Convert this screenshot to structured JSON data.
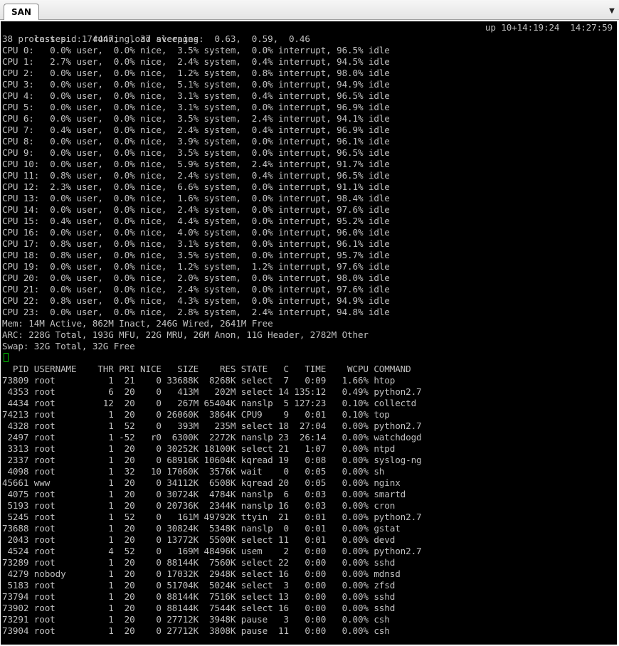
{
  "tab": {
    "label": "SAN"
  },
  "summary": {
    "left": "last pid: 74447;  load averages:  0.63,  0.59,  0.46",
    "uptime": "up 10+14:19:24  14:27:59",
    "processes": "38 processes:  1 running, 37 sleeping"
  },
  "cpus": [
    "CPU 0:   0.0% user,  0.0% nice,  3.5% system,  0.0% interrupt, 96.5% idle",
    "CPU 1:   2.7% user,  0.0% nice,  2.4% system,  0.4% interrupt, 94.5% idle",
    "CPU 2:   0.0% user,  0.0% nice,  1.2% system,  0.8% interrupt, 98.0% idle",
    "CPU 3:   0.0% user,  0.0% nice,  5.1% system,  0.0% interrupt, 94.9% idle",
    "CPU 4:   0.0% user,  0.0% nice,  3.1% system,  0.4% interrupt, 96.5% idle",
    "CPU 5:   0.0% user,  0.0% nice,  3.1% system,  0.0% interrupt, 96.9% idle",
    "CPU 6:   0.0% user,  0.0% nice,  3.5% system,  2.4% interrupt, 94.1% idle",
    "CPU 7:   0.4% user,  0.0% nice,  2.4% system,  0.4% interrupt, 96.9% idle",
    "CPU 8:   0.0% user,  0.0% nice,  3.9% system,  0.0% interrupt, 96.1% idle",
    "CPU 9:   0.0% user,  0.0% nice,  3.5% system,  0.0% interrupt, 96.5% idle",
    "CPU 10:  0.0% user,  0.0% nice,  5.9% system,  2.4% interrupt, 91.7% idle",
    "CPU 11:  0.8% user,  0.0% nice,  2.4% system,  0.4% interrupt, 96.5% idle",
    "CPU 12:  2.3% user,  0.0% nice,  6.6% system,  0.0% interrupt, 91.1% idle",
    "CPU 13:  0.0% user,  0.0% nice,  1.6% system,  0.0% interrupt, 98.4% idle",
    "CPU 14:  0.0% user,  0.0% nice,  2.4% system,  0.0% interrupt, 97.6% idle",
    "CPU 15:  0.4% user,  0.0% nice,  4.4% system,  0.0% interrupt, 95.2% idle",
    "CPU 16:  0.0% user,  0.0% nice,  4.0% system,  0.0% interrupt, 96.0% idle",
    "CPU 17:  0.8% user,  0.0% nice,  3.1% system,  0.0% interrupt, 96.1% idle",
    "CPU 18:  0.8% user,  0.0% nice,  3.5% system,  0.0% interrupt, 95.7% idle",
    "CPU 19:  0.0% user,  0.0% nice,  1.2% system,  1.2% interrupt, 97.6% idle",
    "CPU 20:  0.0% user,  0.0% nice,  2.0% system,  0.0% interrupt, 98.0% idle",
    "CPU 21:  0.0% user,  0.0% nice,  2.4% system,  0.0% interrupt, 97.6% idle",
    "CPU 22:  0.8% user,  0.0% nice,  4.3% system,  0.0% interrupt, 94.9% idle",
    "CPU 23:  0.0% user,  0.0% nice,  2.8% system,  2.4% interrupt, 94.8% idle"
  ],
  "mem": "Mem: 14M Active, 862M Inact, 246G Wired, 2641M Free",
  "arc": "ARC: 228G Total, 193G MFU, 22G MRU, 26M Anon, 11G Header, 2782M Other",
  "swap": "Swap: 32G Total, 32G Free",
  "table": {
    "header": "  PID USERNAME    THR PRI NICE   SIZE    RES STATE   C   TIME    WCPU COMMAND",
    "rows": [
      "73809 root          1  21    0 33688K  8268K select  7   0:09   1.66% htop",
      " 4353 root          6  20    0   413M   202M select 14 135:12   0.49% python2.7",
      " 4434 root         12  20    0   267M 65404K nanslp  5 127:23   0.10% collectd",
      "74213 root          1  20    0 26060K  3864K CPU9    9   0:01   0.10% top",
      " 4328 root          1  52    0   393M   235M select 18  27:04   0.00% python2.7",
      " 2497 root          1 -52   r0  6300K  2272K nanslp 23  26:14   0.00% watchdogd",
      " 3313 root          1  20    0 30252K 18100K select 21   1:07   0.00% ntpd",
      " 2337 root          1  20    0 68916K 10604K kqread 19   0:08   0.00% syslog-ng",
      " 4098 root          1  32   10 17060K  3576K wait    0   0:05   0.00% sh",
      "45661 www           1  20    0 34112K  6508K kqread 20   0:05   0.00% nginx",
      " 4075 root          1  20    0 30724K  4784K nanslp  6   0:03   0.00% smartd",
      " 5193 root          1  20    0 20736K  2344K nanslp 16   0:03   0.00% cron",
      " 5245 root          1  52    0   161M 49792K ttyin  21   0:01   0.00% python2.7",
      "73688 root          1  20    0 30824K  5348K nanslp  0   0:01   0.00% gstat",
      " 2043 root          1  20    0 13772K  5500K select 11   0:01   0.00% devd",
      " 4524 root          4  52    0   169M 48496K usem    2   0:00   0.00% python2.7",
      "73289 root          1  20    0 88144K  7560K select 22   0:00   0.00% sshd",
      " 4279 nobody        1  20    0 17032K  2948K select 16   0:00   0.00% mdnsd",
      " 5183 root          1  20    0 51704K  5024K select  3   0:00   0.00% zfsd",
      "73794 root          1  20    0 88144K  7516K select 13   0:00   0.00% sshd",
      "73902 root          1  20    0 88144K  7544K select 16   0:00   0.00% sshd",
      "73291 root          1  20    0 27712K  3948K pause   3   0:00   0.00% csh",
      "73904 root          1  20    0 27712K  3808K pause  11   0:00   0.00% csh"
    ]
  },
  "colors": {
    "background": "#000000",
    "text": "#c0c0c0",
    "cursor": "#00c000"
  },
  "icons": {
    "tab_menu": "chevron-down-icon"
  }
}
